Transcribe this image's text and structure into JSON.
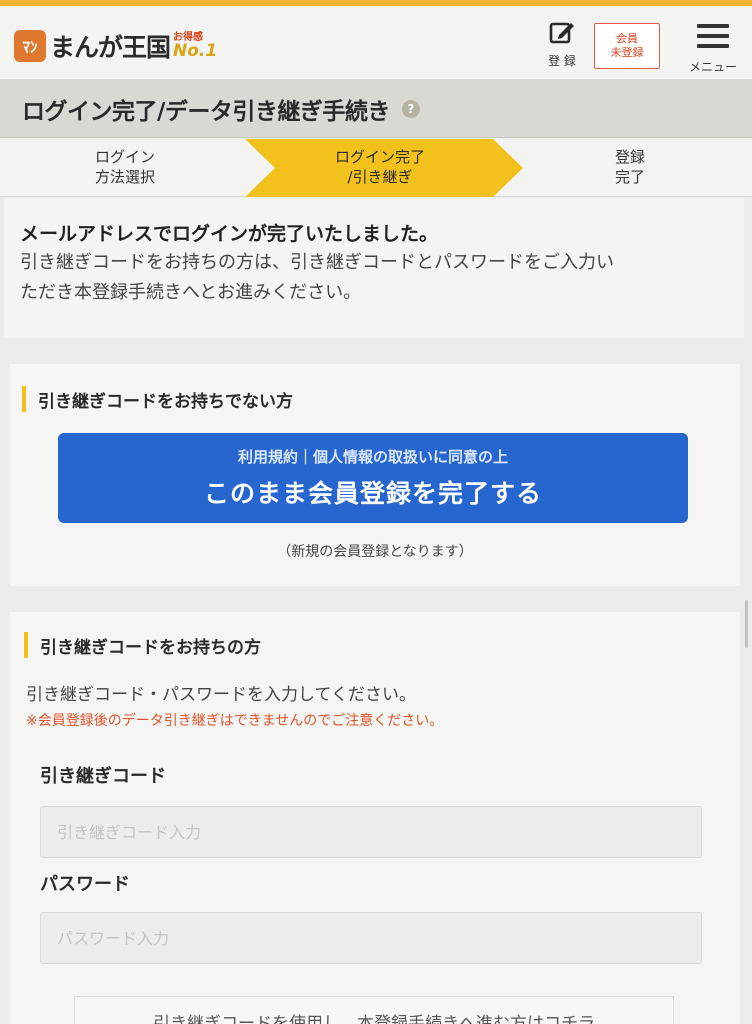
{
  "header": {
    "logo_mark": "ﾏﾝ",
    "logo_text": "まんが王国",
    "logo_badge_small": "お得感",
    "logo_badge_big": "No.1",
    "register_label": "登 録",
    "member_status_line1": "会員",
    "member_status_line2": "未登録",
    "menu_label": "メニュー"
  },
  "title": {
    "text": "ログイン完了/データ引き継ぎ手続き",
    "help": "?"
  },
  "steps": [
    {
      "line1": "ログイン",
      "line2": "方法選択"
    },
    {
      "line1": "ログイン完了",
      "line2": "/引き継ぎ"
    },
    {
      "line1": "登録",
      "line2": "完了"
    }
  ],
  "intro": {
    "bold": "メールアドレスでログインが完了いたしました。",
    "line1": "引き継ぎコードをお持ちの方は、引き継ぎコードとパスワードをご入力い",
    "line2": "ただき本登録手続きへとお進みください。"
  },
  "no_code_section": {
    "heading": "引き継ぎコードをお持ちでない方",
    "cta_sub": "利用規約｜個人情報の取扱いに同意の上",
    "cta_main": "このまま会員登録を完了する",
    "note": "（新規の会員登録となります）"
  },
  "code_section": {
    "heading": "引き継ぎコードをお持ちの方",
    "description": "引き継ぎコード・パスワードを入力してください。",
    "warning": "※会員登録後のデータ引き継ぎはできませんのでご注意ください。",
    "code_label": "引き継ぎコード",
    "code_placeholder": "引き継ぎコード入力",
    "password_label": "パスワード",
    "password_placeholder": "パスワード入力",
    "bottom_text": "引き継ぎコードを使用し、本登録手続きへ進む方はコチラ"
  },
  "colors": {
    "accent_yellow": "#f2c11c",
    "cta_blue": "#2765cf",
    "warning_red": "#e0522a"
  }
}
